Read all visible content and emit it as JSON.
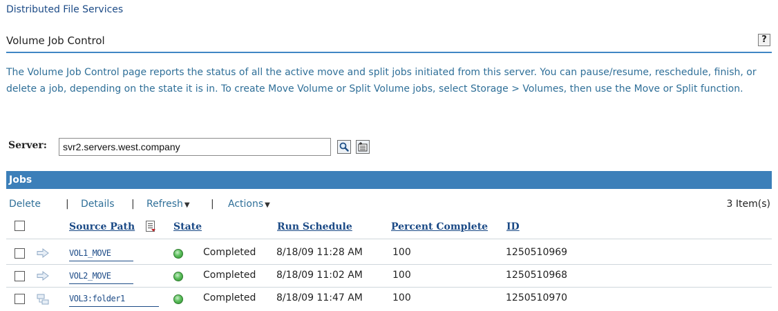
{
  "breadcrumb": "Distributed File Services",
  "page_title": "Volume Job Control",
  "help_label": "?",
  "description": "The Volume Job Control page reports the status of all the active move and split jobs initiated from this server. You can pause/resume, reschedule, finish, or delete a job, depending on the state it is in. To create Move Volume or Split Volume jobs, select Storage > Volumes, then use the Move or Split function.",
  "server": {
    "label": "Server:",
    "value": "svr2.servers.west.company",
    "search_icon": "search-icon",
    "browse_icon": "object-browser-icon"
  },
  "jobs": {
    "title": "Jobs",
    "toolbar": {
      "delete": "Delete",
      "details": "Details",
      "refresh": "Refresh",
      "actions": "Actions",
      "separator": "|",
      "count": "3 Item(s)"
    },
    "columns": {
      "source_path": "Source Path",
      "state": "State",
      "run_schedule": "Run Schedule",
      "percent_complete": "Percent Complete",
      "id": "ID"
    },
    "rows": [
      {
        "type_icon": "move-arrow-icon",
        "source_path": "VOL1_MOVE",
        "state": "Completed",
        "run_schedule": "8/18/09 11:28 AM",
        "percent_complete": "100",
        "id": "1250510969"
      },
      {
        "type_icon": "move-arrow-icon",
        "source_path": "VOL2_MOVE",
        "state": "Completed",
        "run_schedule": "8/18/09 11:02 AM",
        "percent_complete": "100",
        "id": "1250510968"
      },
      {
        "type_icon": "split-folder-icon",
        "source_path": "VOL3:folder1",
        "state": "Completed",
        "run_schedule": "8/18/09 11:47 AM",
        "percent_complete": "100",
        "id": "1250510970"
      }
    ]
  },
  "colors": {
    "accent_blue": "#3c7fb9",
    "link_blue": "#1b4a86",
    "desc_text": "#2f6f98",
    "state_green": "#5dbf5d"
  }
}
